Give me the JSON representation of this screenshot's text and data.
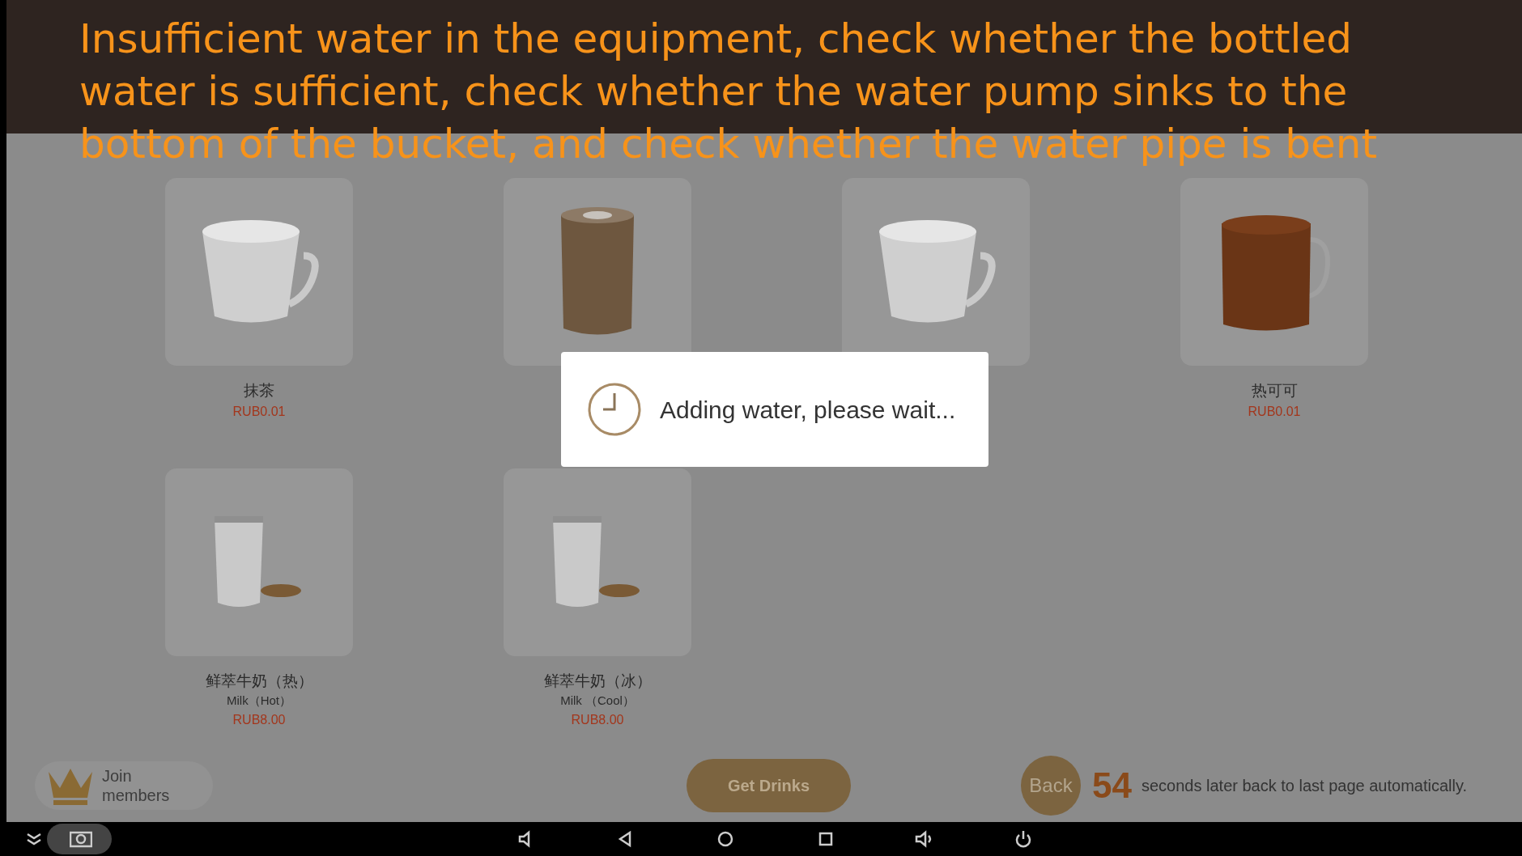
{
  "caption": {
    "lines": [
      "Insufficient water in the equipment, check whether the bottled",
      "water is sufficient, check whether the water pump sinks to the",
      "bottom of the bucket, and check whether the water pipe is bent"
    ]
  },
  "products": [
    {
      "kind": "white-mug",
      "name": "抹茶",
      "price": "RUB0.01"
    },
    {
      "kind": "tall-glass"
    },
    {
      "kind": "white-mug"
    },
    {
      "kind": "brown-mug",
      "name": "热可可",
      "price": "RUB0.01"
    },
    {
      "kind": "milk-glass",
      "name": "鲜萃牛奶（热）",
      "subtitle": "Milk（Hot）",
      "price": "RUB8.00"
    },
    {
      "kind": "milk-glass",
      "name": "鲜萃牛奶（冰）",
      "subtitle": "Milk （Cool）",
      "price": "RUB8.00"
    }
  ],
  "dialog": {
    "message": "Adding water, please wait..."
  },
  "footer": {
    "join": "Join members",
    "get_drinks": "Get Drinks",
    "back": "Back",
    "countdown": "54",
    "countdown_text": "seconds later back to last page automatically."
  }
}
